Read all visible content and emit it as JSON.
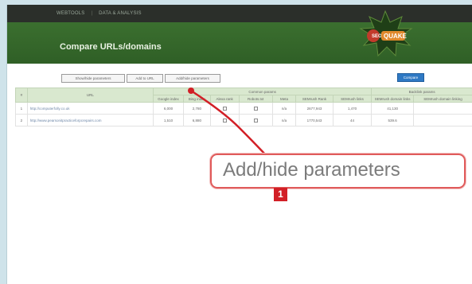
{
  "topnav": {
    "links": [
      "WEBTOOLS",
      "DATA & ANALYSIS"
    ]
  },
  "header": {
    "title": "Compare URLs/domains",
    "logo_text": "SEO QUAKE"
  },
  "toolbar": {
    "buttons": [
      "Show/hide parameters",
      "Add to URL",
      "Add/hide parameters"
    ],
    "primary_label": "Compare"
  },
  "table": {
    "col_hash": "#",
    "col_url": "URL",
    "group1_label": "Common params",
    "group2_label": "Backlink params",
    "sub_headers": [
      "Google index",
      "Bing index",
      "Alexa rank",
      "Robots.txt",
      "Meta",
      "SEMrush Rank",
      "SEMrush links",
      "SEMrush domain links",
      "SEMrush domain linking"
    ],
    "rows": [
      {
        "n": "1",
        "url": "http://computerfolly.co.uk",
        "vals": [
          "6,000",
          "2,780",
          "",
          "",
          "n/a",
          "2677,943",
          "1,470",
          "41,130"
        ]
      },
      {
        "n": "2",
        "url": "http://www.pearsonitpracticeforpcrepairs.com",
        "vals": [
          "1,510",
          "6,880",
          "",
          "",
          "n/a",
          "1770,543",
          "44",
          "539.6"
        ]
      }
    ]
  },
  "callout": {
    "text": "Add/hide parameters",
    "badge": "1"
  },
  "colors": {
    "header_green": "#3b6f2f",
    "callout_red": "#d21f26",
    "compare_blue": "#2f79c4"
  }
}
